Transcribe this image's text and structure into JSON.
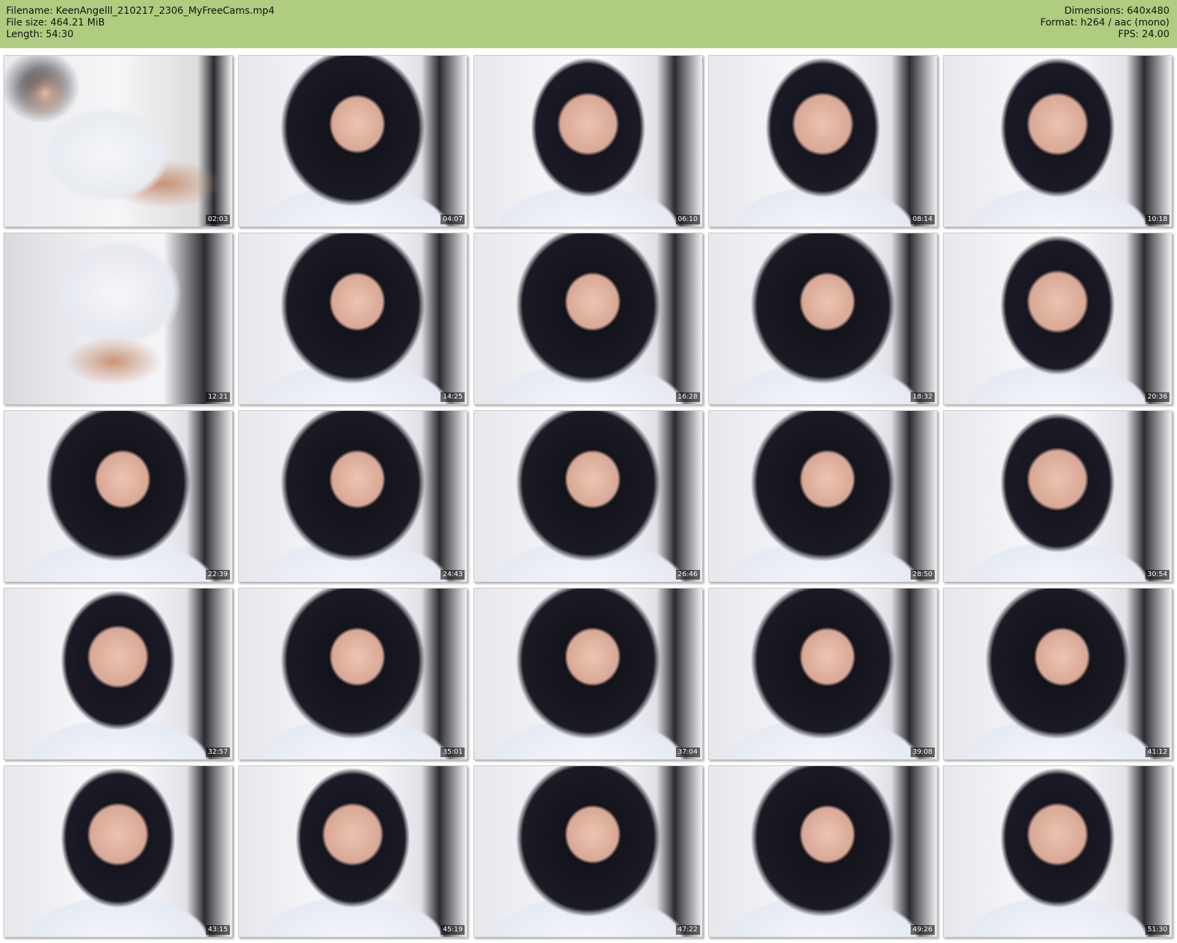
{
  "header": {
    "filename_line": "Filename: KeenAngelll_210217_2306_MyFreeCams.mp4",
    "filesize_line": "File size: 464.21 MiB",
    "length_line": "Length: 54:30",
    "dimensions_line": "Dimensions: 640x480",
    "format_line": "Format: h264 / aac (mono)",
    "fps_line": "FPS: 24.00",
    "background_color": "#b0cc80"
  },
  "thumbnails": [
    {
      "timestamp": "02:03"
    },
    {
      "timestamp": "04:07"
    },
    {
      "timestamp": "06:10"
    },
    {
      "timestamp": "08:14"
    },
    {
      "timestamp": "10:18"
    },
    {
      "timestamp": "12:21"
    },
    {
      "timestamp": "14:25"
    },
    {
      "timestamp": "16:28"
    },
    {
      "timestamp": "18:32"
    },
    {
      "timestamp": "20:36"
    },
    {
      "timestamp": "22:39"
    },
    {
      "timestamp": "24:43"
    },
    {
      "timestamp": "26:46"
    },
    {
      "timestamp": "28:50"
    },
    {
      "timestamp": "30:54"
    },
    {
      "timestamp": "32:57"
    },
    {
      "timestamp": "35:01"
    },
    {
      "timestamp": "37:04"
    },
    {
      "timestamp": "39:08"
    },
    {
      "timestamp": "41:12"
    },
    {
      "timestamp": "43:15"
    },
    {
      "timestamp": "45:19"
    },
    {
      "timestamp": "47:22"
    },
    {
      "timestamp": "49:26"
    },
    {
      "timestamp": "51:30"
    }
  ]
}
